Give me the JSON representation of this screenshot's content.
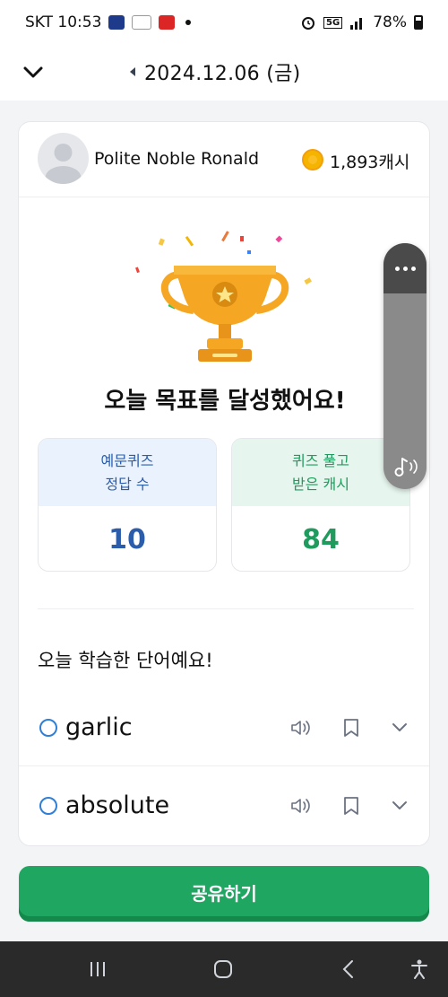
{
  "status_bar": {
    "carrier_time": "SKT 10:53",
    "battery": "78%",
    "network": "5G"
  },
  "header": {
    "date": "2024.12.06 (금)"
  },
  "profile": {
    "name": "Polite Noble Ronald",
    "cash": "1,893캐시"
  },
  "result": {
    "title": "오늘 목표를 달성했어요!",
    "stats": [
      {
        "label_line1": "예문퀴즈",
        "label_line2": "정답 수",
        "value": "10"
      },
      {
        "label_line1": "퀴즈 풀고",
        "label_line2": "받은 캐시",
        "value": "84"
      }
    ]
  },
  "learned": {
    "title": "오늘 학습한 단어예요!",
    "words": [
      "garlic",
      "absolute"
    ]
  },
  "share_button": "공유하기",
  "colors": {
    "primary_green": "#1fa661",
    "stat_blue": "#2b5dab",
    "stat_green": "#1f9b5d",
    "trophy_gold": "#f5a623"
  }
}
